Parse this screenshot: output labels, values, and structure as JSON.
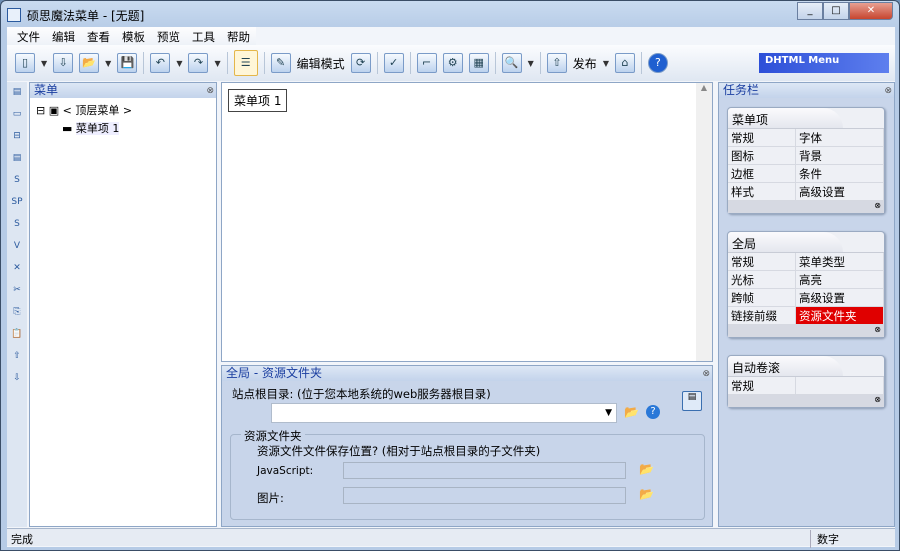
{
  "window": {
    "title": "硕思魔法菜单 - [无题]"
  },
  "menu": [
    "文件",
    "编辑",
    "查看",
    "模板",
    "预览",
    "工具",
    "帮助"
  ],
  "toolbar": {
    "edit_mode": "编辑模式",
    "publish": "发布",
    "banner": "DHTML Menu"
  },
  "left_panel": {
    "title": "菜单",
    "root": "< 顶层菜单 >",
    "child": "菜单项 1"
  },
  "canvas": {
    "menu_item": "菜单项 1"
  },
  "bottom_panel": {
    "title": "全局 - 资源文件夹",
    "site_root_label": "站点根目录: (位于您本地系统的web服务器根目录)",
    "site_root_value": "",
    "group_title": "资源文件夹",
    "question": "资源文件文件保存位置? (相对于站点根目录的子文件夹)",
    "js_label": "JavaScript:",
    "js_value": "",
    "img_label": "图片:",
    "img_value": ""
  },
  "task_panel": {
    "title": "任务栏",
    "cards": [
      {
        "title": "菜单项",
        "items": [
          "常规",
          "字体",
          "图标",
          "背景",
          "边框",
          "条件",
          "样式",
          "高级设置"
        ]
      },
      {
        "title": "全局",
        "items": [
          "常规",
          "菜单类型",
          "光标",
          "高亮",
          "跨帧",
          "高级设置",
          "链接前缀",
          "资源文件夹"
        ]
      },
      {
        "title": "自动卷滚",
        "items": [
          "常规",
          ""
        ]
      }
    ]
  },
  "status": {
    "text": "完成",
    "mode": "数字"
  },
  "colors": {
    "selected": "#e00000",
    "panel": "#c8d5ea"
  }
}
